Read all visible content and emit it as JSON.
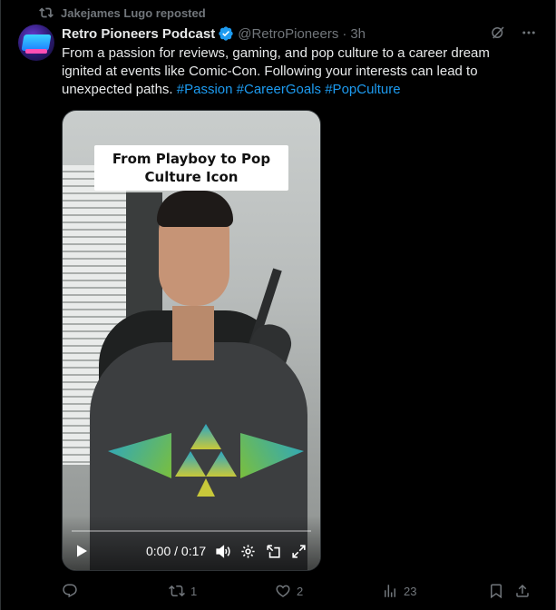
{
  "repost": {
    "label": "Jakejames Lugo reposted",
    "icon": "repost-icon"
  },
  "author": {
    "name": "Retro Pioneers Podcast",
    "handle": "@RetroPioneers",
    "separator": "·",
    "time": "3h",
    "verified_color": "#1d9bf0"
  },
  "post": {
    "text": "From a passion for reviews, gaming, and pop culture to a career dream ignited at events like Comic-Con. Following your interests can lead to unexpected paths.",
    "hashtags": [
      "#Passion",
      "#CareerGoals",
      "#PopCulture"
    ]
  },
  "video": {
    "caption": "From Playboy to Pop Culture Icon",
    "time_display": "0:00 / 0:17",
    "progress": 0
  },
  "actions": {
    "replies": "",
    "reposts": "1",
    "likes": "2",
    "views": "23"
  },
  "colors": {
    "accent": "#1d9bf0",
    "muted": "#71767b",
    "text": "#e7e9ea",
    "background": "#000000"
  }
}
